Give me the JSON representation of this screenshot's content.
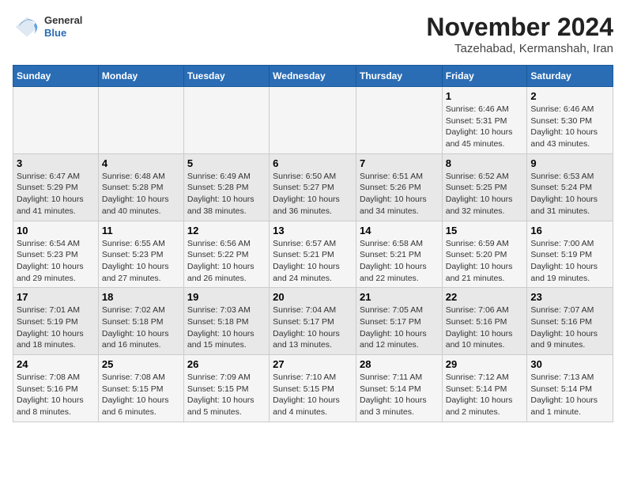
{
  "header": {
    "logo_general": "General",
    "logo_blue": "Blue",
    "title": "November 2024",
    "subtitle": "Tazehabad, Kermanshah, Iran"
  },
  "days_of_week": [
    "Sunday",
    "Monday",
    "Tuesday",
    "Wednesday",
    "Thursday",
    "Friday",
    "Saturday"
  ],
  "weeks": [
    [
      {
        "day": "",
        "info": ""
      },
      {
        "day": "",
        "info": ""
      },
      {
        "day": "",
        "info": ""
      },
      {
        "day": "",
        "info": ""
      },
      {
        "day": "",
        "info": ""
      },
      {
        "day": "1",
        "info": "Sunrise: 6:46 AM\nSunset: 5:31 PM\nDaylight: 10 hours and 45 minutes."
      },
      {
        "day": "2",
        "info": "Sunrise: 6:46 AM\nSunset: 5:30 PM\nDaylight: 10 hours and 43 minutes."
      }
    ],
    [
      {
        "day": "3",
        "info": "Sunrise: 6:47 AM\nSunset: 5:29 PM\nDaylight: 10 hours and 41 minutes."
      },
      {
        "day": "4",
        "info": "Sunrise: 6:48 AM\nSunset: 5:28 PM\nDaylight: 10 hours and 40 minutes."
      },
      {
        "day": "5",
        "info": "Sunrise: 6:49 AM\nSunset: 5:28 PM\nDaylight: 10 hours and 38 minutes."
      },
      {
        "day": "6",
        "info": "Sunrise: 6:50 AM\nSunset: 5:27 PM\nDaylight: 10 hours and 36 minutes."
      },
      {
        "day": "7",
        "info": "Sunrise: 6:51 AM\nSunset: 5:26 PM\nDaylight: 10 hours and 34 minutes."
      },
      {
        "day": "8",
        "info": "Sunrise: 6:52 AM\nSunset: 5:25 PM\nDaylight: 10 hours and 32 minutes."
      },
      {
        "day": "9",
        "info": "Sunrise: 6:53 AM\nSunset: 5:24 PM\nDaylight: 10 hours and 31 minutes."
      }
    ],
    [
      {
        "day": "10",
        "info": "Sunrise: 6:54 AM\nSunset: 5:23 PM\nDaylight: 10 hours and 29 minutes."
      },
      {
        "day": "11",
        "info": "Sunrise: 6:55 AM\nSunset: 5:23 PM\nDaylight: 10 hours and 27 minutes."
      },
      {
        "day": "12",
        "info": "Sunrise: 6:56 AM\nSunset: 5:22 PM\nDaylight: 10 hours and 26 minutes."
      },
      {
        "day": "13",
        "info": "Sunrise: 6:57 AM\nSunset: 5:21 PM\nDaylight: 10 hours and 24 minutes."
      },
      {
        "day": "14",
        "info": "Sunrise: 6:58 AM\nSunset: 5:21 PM\nDaylight: 10 hours and 22 minutes."
      },
      {
        "day": "15",
        "info": "Sunrise: 6:59 AM\nSunset: 5:20 PM\nDaylight: 10 hours and 21 minutes."
      },
      {
        "day": "16",
        "info": "Sunrise: 7:00 AM\nSunset: 5:19 PM\nDaylight: 10 hours and 19 minutes."
      }
    ],
    [
      {
        "day": "17",
        "info": "Sunrise: 7:01 AM\nSunset: 5:19 PM\nDaylight: 10 hours and 18 minutes."
      },
      {
        "day": "18",
        "info": "Sunrise: 7:02 AM\nSunset: 5:18 PM\nDaylight: 10 hours and 16 minutes."
      },
      {
        "day": "19",
        "info": "Sunrise: 7:03 AM\nSunset: 5:18 PM\nDaylight: 10 hours and 15 minutes."
      },
      {
        "day": "20",
        "info": "Sunrise: 7:04 AM\nSunset: 5:17 PM\nDaylight: 10 hours and 13 minutes."
      },
      {
        "day": "21",
        "info": "Sunrise: 7:05 AM\nSunset: 5:17 PM\nDaylight: 10 hours and 12 minutes."
      },
      {
        "day": "22",
        "info": "Sunrise: 7:06 AM\nSunset: 5:16 PM\nDaylight: 10 hours and 10 minutes."
      },
      {
        "day": "23",
        "info": "Sunrise: 7:07 AM\nSunset: 5:16 PM\nDaylight: 10 hours and 9 minutes."
      }
    ],
    [
      {
        "day": "24",
        "info": "Sunrise: 7:08 AM\nSunset: 5:16 PM\nDaylight: 10 hours and 8 minutes."
      },
      {
        "day": "25",
        "info": "Sunrise: 7:08 AM\nSunset: 5:15 PM\nDaylight: 10 hours and 6 minutes."
      },
      {
        "day": "26",
        "info": "Sunrise: 7:09 AM\nSunset: 5:15 PM\nDaylight: 10 hours and 5 minutes."
      },
      {
        "day": "27",
        "info": "Sunrise: 7:10 AM\nSunset: 5:15 PM\nDaylight: 10 hours and 4 minutes."
      },
      {
        "day": "28",
        "info": "Sunrise: 7:11 AM\nSunset: 5:14 PM\nDaylight: 10 hours and 3 minutes."
      },
      {
        "day": "29",
        "info": "Sunrise: 7:12 AM\nSunset: 5:14 PM\nDaylight: 10 hours and 2 minutes."
      },
      {
        "day": "30",
        "info": "Sunrise: 7:13 AM\nSunset: 5:14 PM\nDaylight: 10 hours and 1 minute."
      }
    ]
  ]
}
